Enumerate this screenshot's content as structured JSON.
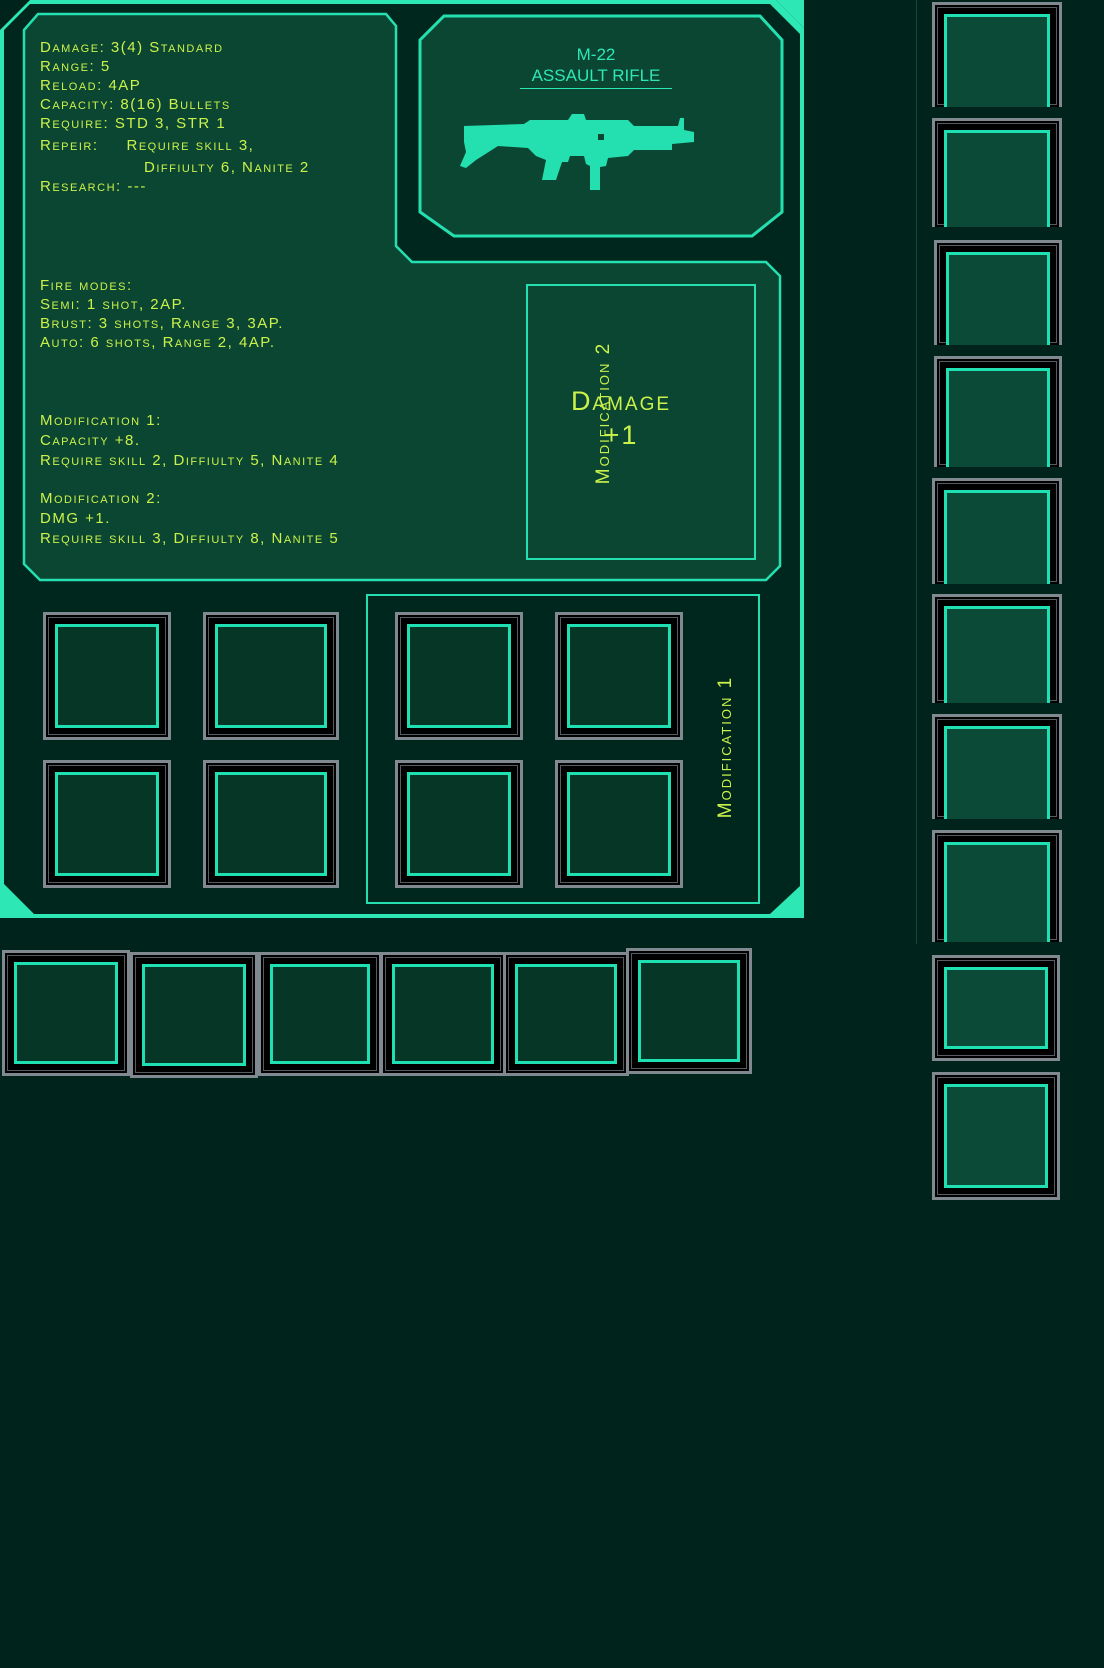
{
  "weapon": {
    "model": "M-22",
    "class": "ASSAULT RIFLE"
  },
  "stats": {
    "damage": "Damage: 3(4) Standard",
    "range": "Range: 5",
    "reload": "Reload: 4AP",
    "capacity": "Capacity: 8(16) Bullets",
    "require": "Require: STD 3, STR 1",
    "repair_label": "Repeir:",
    "repair_line1": "Require skill 3,",
    "repair_line2": "Diffiulty 6, Nanite 2",
    "research": "Research: ---"
  },
  "fire_modes": {
    "title": "Fire modes:",
    "semi": "Semi: 1 shot, 2AP.",
    "burst": "Brust: 3 shots, Range 3, 3AP.",
    "auto": "Auto: 6 shots, Range 2, 4AP."
  },
  "modifications_text": {
    "mod1_title": "Modification 1:",
    "mod1_effect": "Capacity +8.",
    "mod1_require": "Require skill 2, Diffiulty 5, Nanite 4",
    "mod2_title": "Modification 2:",
    "mod2_effect": "DMG +1.",
    "mod2_require": "Require skill 3, Diffiulty 8, Nanite 5"
  },
  "modification2_panel": {
    "value_line1": "Damage",
    "value_line2": "+1",
    "label": "Modification 2"
  },
  "modification1_panel": {
    "label": "Modification 1"
  },
  "slots": {
    "panel_left_count": 4,
    "mod1_count": 4,
    "bottom_row_count": 6,
    "right_column_count": 10
  },
  "colors": {
    "background": "#00241b",
    "panel_fill": "#0b4633",
    "accent_cyan": "#24e0b0",
    "text_yellow_green": "#cbf24a",
    "slot_frame_gray": "#808890"
  },
  "icons": {
    "weapon": "assault-rifle-icon"
  }
}
